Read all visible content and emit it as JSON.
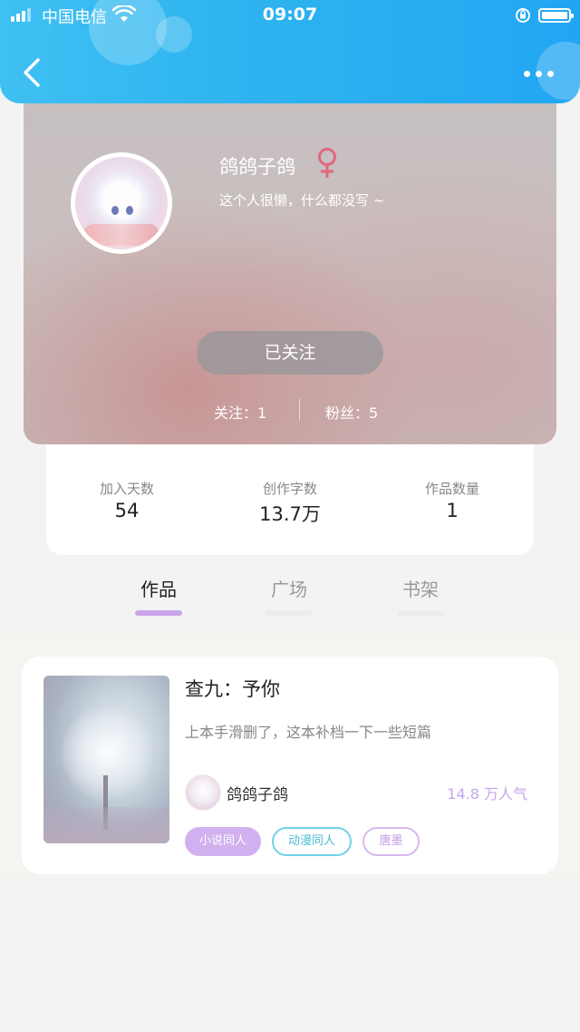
{
  "status_bar": {
    "carrier": "中国电信",
    "time": "09:07"
  },
  "profile": {
    "username": "鸽鸽子鸽",
    "gender_icon": "female-symbol-icon",
    "gender_color": "#e0697f",
    "bio": "这个人很懒，什么都没写 ~",
    "follow_button": "已关注",
    "following_label": "关注：1",
    "followers_label": "粉丝：5"
  },
  "stats": [
    {
      "label": "加入天数",
      "value": "54"
    },
    {
      "label": "创作字数",
      "value": "13.7万"
    },
    {
      "label": "作品数量",
      "value": "1"
    }
  ],
  "tabs": [
    {
      "label": "作品",
      "active": true
    },
    {
      "label": "广场",
      "active": false
    },
    {
      "label": "书架",
      "active": false
    }
  ],
  "works": [
    {
      "title": "查九：予你",
      "description": "上本手滑删了，这本补档一下一些短篇",
      "author": "鸽鸽子鸽",
      "popularity": "14.8 万人气",
      "tags": [
        "小说同人",
        "动漫同人",
        "唐墨"
      ]
    }
  ],
  "colors": {
    "header_blue": "#2fb4f0",
    "accent_purple": "#c9a6ea",
    "tag_cyan": "#6fd3e6"
  }
}
